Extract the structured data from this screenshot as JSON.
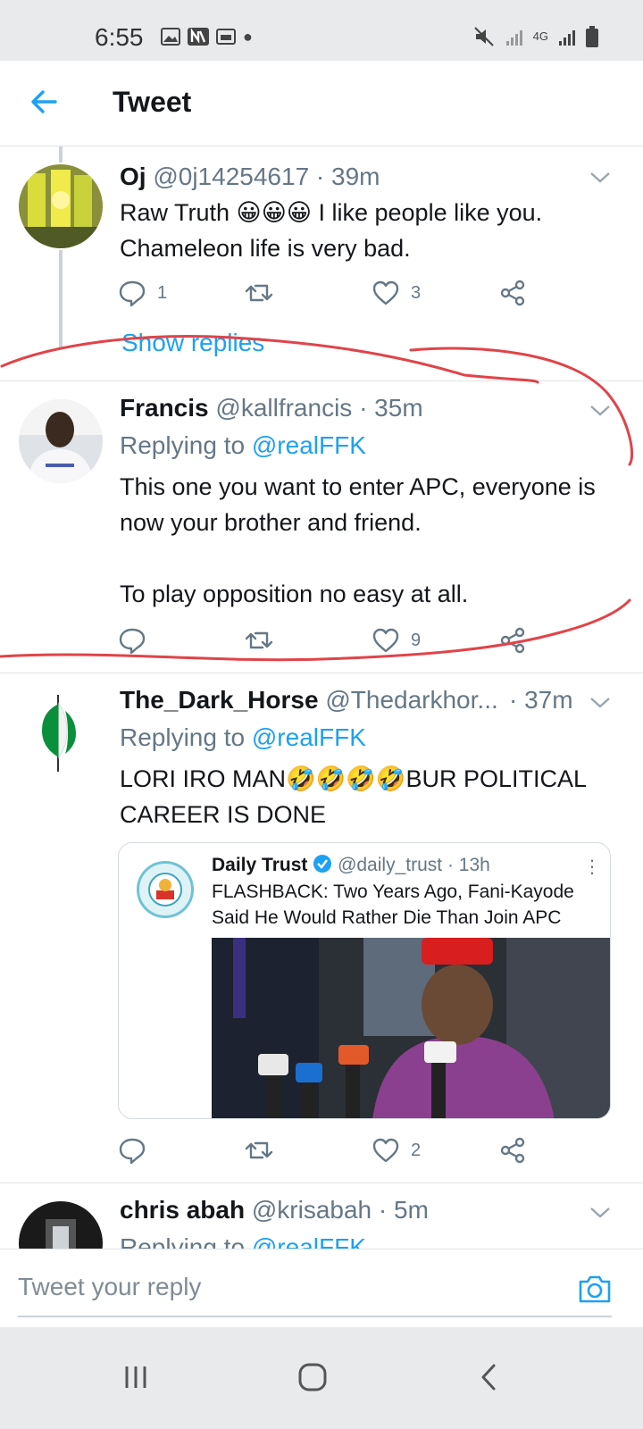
{
  "status_bar": {
    "time": "6:55",
    "network": "4G"
  },
  "header": {
    "title": "Tweet"
  },
  "tweets": [
    {
      "name": "Oj",
      "handle": "@0j14254617",
      "time": "· 39m",
      "text": "Raw Truth 😀😀😀 I like people like you. Chameleon life is very bad.",
      "replies": "1",
      "retweets": "",
      "likes": "3",
      "show_replies": "Show replies"
    },
    {
      "name": "Francis",
      "handle": "@kallfrancis",
      "time": "· 35m",
      "replying_label": "Replying to",
      "replying_handle": "@realFFK",
      "text": "This one you want to enter APC, everyone is now your brother and friend.\n\nTo play opposition no easy at all.",
      "replies": "",
      "retweets": "",
      "likes": "9"
    },
    {
      "name": "The_Dark_Horse",
      "handle": "@Thedarkhor...",
      "time": "· 37m",
      "replying_label": "Replying to",
      "replying_handle": "@realFFK",
      "text": "LORI IRO MAN🤣🤣🤣🤣BUR POLITICAL CAREER IS DONE",
      "replies": "",
      "retweets": "",
      "likes": "2",
      "quote": {
        "name": "Daily Trust",
        "handle": "@daily_trust",
        "time": "· 13h",
        "text": "FLASHBACK: Two Years Ago, Fani-Kayode Said He Would Rather Die Than Join APC"
      }
    },
    {
      "name": "chris abah",
      "handle": "@krisabah",
      "time": "· 5m",
      "replying_label": "Replying to",
      "replying_handle": "@realFFK"
    }
  ],
  "reply_bar": {
    "placeholder": "Tweet your reply"
  },
  "colors": {
    "accent": "#1da1f2",
    "annotation": "#e0444a",
    "secondary_text": "#657786"
  },
  "icons": [
    "back-arrow-icon",
    "chevron-down-icon",
    "reply-icon",
    "retweet-icon",
    "like-icon",
    "share-icon",
    "verified-icon",
    "camera-icon",
    "recent-apps-icon",
    "home-icon",
    "back-nav-icon"
  ]
}
